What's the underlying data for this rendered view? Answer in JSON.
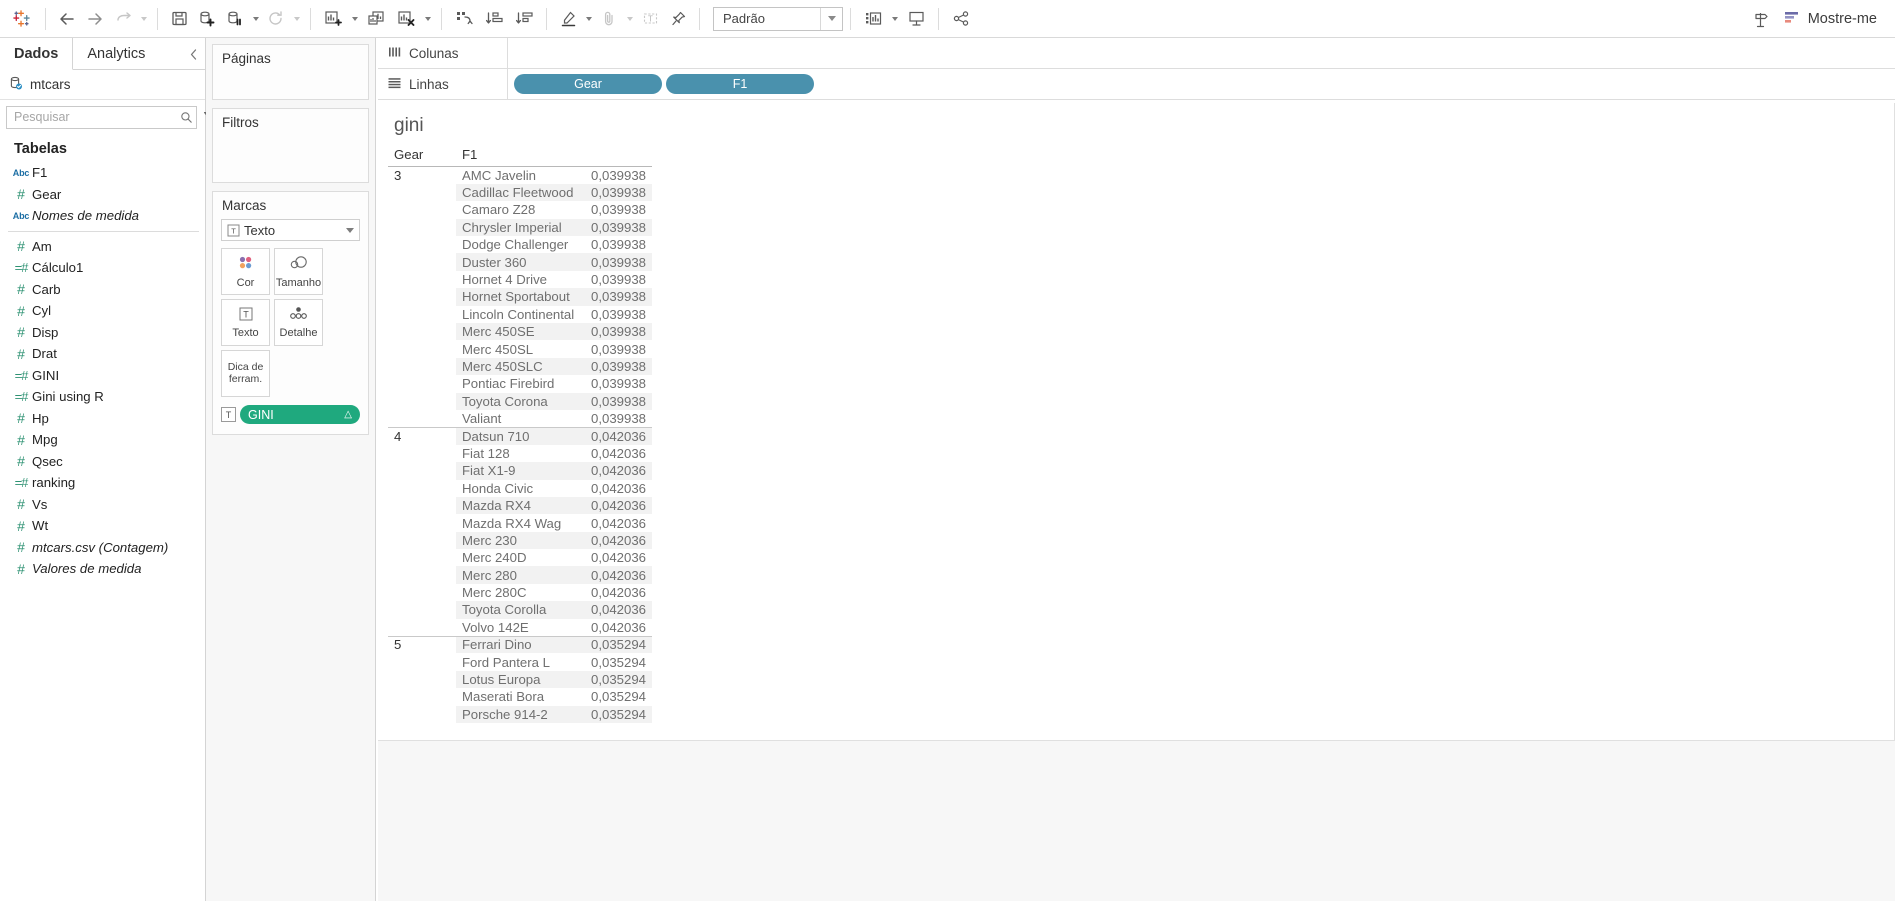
{
  "toolbar": {
    "logo_icon": "tableau-logo-icon",
    "groups": [
      {
        "items": [
          {
            "name": "back-button",
            "icon": "arrow-left-icon",
            "dim": false,
            "caret": false
          },
          {
            "name": "forward-button",
            "icon": "arrow-right-icon",
            "dim": false,
            "caret": false
          },
          {
            "name": "undo-redo-button",
            "icon": "redo-arrow-icon",
            "dim": true,
            "caret": true
          }
        ]
      },
      {
        "items": [
          {
            "name": "save-button",
            "icon": "save-floppy-icon",
            "dim": false,
            "caret": false
          },
          {
            "name": "new-data-source-button",
            "icon": "database-plus-icon",
            "dim": false,
            "caret": false
          },
          {
            "name": "pause-data-source-button",
            "icon": "database-pause-icon",
            "dim": false,
            "caret": true
          },
          {
            "name": "refresh-data-source-button",
            "icon": "refresh-circular-icon",
            "dim": true,
            "caret": true
          }
        ]
      },
      {
        "items": [
          {
            "name": "new-worksheet-button",
            "icon": "chart-plus-icon",
            "dim": false,
            "caret": true
          },
          {
            "name": "duplicate-sheet-button",
            "icon": "chart-duplicate-icon",
            "dim": false,
            "caret": false
          },
          {
            "name": "clear-sheet-button",
            "icon": "chart-clear-x-icon",
            "dim": false,
            "caret": true
          }
        ]
      },
      {
        "items": [
          {
            "name": "swap-rows-columns-button",
            "icon": "swap-axes-icon",
            "dim": false,
            "caret": false
          },
          {
            "name": "sort-ascending-button",
            "icon": "sort-ascending-icon",
            "dim": false,
            "caret": false
          },
          {
            "name": "sort-descending-button",
            "icon": "sort-descending-icon",
            "dim": false,
            "caret": false
          }
        ]
      },
      {
        "items": [
          {
            "name": "highlight-button",
            "icon": "highlighter-pen-icon",
            "dim": false,
            "caret": true
          },
          {
            "name": "group-members-button",
            "icon": "paperclip-icon",
            "dim": true,
            "caret": true
          },
          {
            "name": "show-mark-labels-button",
            "icon": "text-label-icon",
            "dim": true,
            "caret": false
          },
          {
            "name": "fix-axes-button",
            "icon": "pushpin-icon",
            "dim": false,
            "caret": false
          }
        ]
      }
    ],
    "fit_select": {
      "value": "Padrão"
    },
    "after_fit": [
      {
        "name": "show-hide-cards-button",
        "icon": "cards-chart-icon",
        "dim": false,
        "caret": true
      },
      {
        "name": "presentation-mode-button",
        "icon": "presentation-screen-icon",
        "dim": false,
        "caret": false
      },
      {
        "name": "share-button",
        "icon": "share-nodes-icon",
        "dim": false,
        "caret": false
      }
    ],
    "signpost_icon": "signpost-icon",
    "show_me_label": "Mostre-me",
    "show_me_icon": "show-me-bars-icon"
  },
  "left_pane": {
    "tabs": [
      {
        "label": "Dados",
        "active": true
      },
      {
        "label": "Analytics",
        "active": false
      }
    ],
    "collapse_icon": "chevron-left-icon",
    "data_source": {
      "label": "mtcars",
      "icon": "database-connected-icon"
    },
    "search": {
      "placeholder": "Pesquisar",
      "value": ""
    },
    "search_icon": "search-magnifier-icon",
    "filter_icon": "funnel-filter-icon",
    "grid_icon": "grid-view-icon",
    "section_title": "Tabelas",
    "fields_group_1": [
      {
        "label": "F1",
        "type": "abc",
        "italic": false
      },
      {
        "label": "Gear",
        "type": "num",
        "italic": false
      },
      {
        "label": "Nomes de medida",
        "type": "abc",
        "italic": true
      }
    ],
    "fields_group_2": [
      {
        "label": "Am",
        "type": "num",
        "italic": false
      },
      {
        "label": "Cálculo1",
        "type": "calc",
        "italic": false
      },
      {
        "label": "Carb",
        "type": "num",
        "italic": false
      },
      {
        "label": "Cyl",
        "type": "num",
        "italic": false
      },
      {
        "label": "Disp",
        "type": "num",
        "italic": false
      },
      {
        "label": "Drat",
        "type": "num",
        "italic": false
      },
      {
        "label": "GINI",
        "type": "calc",
        "italic": false
      },
      {
        "label": "Gini using R",
        "type": "calc",
        "italic": false
      },
      {
        "label": "Hp",
        "type": "num",
        "italic": false
      },
      {
        "label": "Mpg",
        "type": "num",
        "italic": false
      },
      {
        "label": "Qsec",
        "type": "num",
        "italic": false
      },
      {
        "label": "ranking",
        "type": "calc",
        "italic": false
      },
      {
        "label": "Vs",
        "type": "num",
        "italic": false
      },
      {
        "label": "Wt",
        "type": "num",
        "italic": false
      },
      {
        "label": "mtcars.csv (Contagem)",
        "type": "num",
        "italic": true
      },
      {
        "label": "Valores de medida",
        "type": "num",
        "italic": true
      }
    ]
  },
  "cards": {
    "pages_title": "Páginas",
    "filters_title": "Filtros",
    "marks_title": "Marcas",
    "mark_type": {
      "label": "Texto",
      "icon": "text-mark-icon"
    },
    "mark_buttons": [
      {
        "label": "Cor",
        "icon": "color-dots-icon"
      },
      {
        "label": "Tamanho",
        "icon": "size-circles-icon"
      },
      {
        "label": "Texto",
        "icon": "text-box-icon"
      },
      {
        "label": "Detalhe",
        "icon": "detail-dots-icon"
      },
      {
        "label": "Dica de ferram.",
        "icon": "tooltip-icon"
      }
    ],
    "marks_pill": {
      "label": "GINI",
      "icon": "text-mark-icon",
      "suffix": "△",
      "color": "#1fa97e"
    }
  },
  "shelves": {
    "columns": {
      "label": "Colunas",
      "icon": "columns-icon",
      "pills": []
    },
    "rows": {
      "label": "Linhas",
      "icon": "rows-icon",
      "pills": [
        {
          "label": "Gear",
          "color": "#4a91ad"
        },
        {
          "label": "F1",
          "color": "#4a91ad"
        }
      ]
    }
  },
  "viz": {
    "title": "gini",
    "columns": [
      "Gear",
      "F1",
      ""
    ],
    "rows": [
      {
        "gear": "3",
        "f1": "AMC Javelin",
        "value": "0,039938",
        "group_start": true
      },
      {
        "gear": "",
        "f1": "Cadillac Fleetwood",
        "value": "0,039938",
        "group_start": false
      },
      {
        "gear": "",
        "f1": "Camaro Z28",
        "value": "0,039938",
        "group_start": false
      },
      {
        "gear": "",
        "f1": "Chrysler Imperial",
        "value": "0,039938",
        "group_start": false
      },
      {
        "gear": "",
        "f1": "Dodge Challenger",
        "value": "0,039938",
        "group_start": false
      },
      {
        "gear": "",
        "f1": "Duster 360",
        "value": "0,039938",
        "group_start": false
      },
      {
        "gear": "",
        "f1": "Hornet 4 Drive",
        "value": "0,039938",
        "group_start": false
      },
      {
        "gear": "",
        "f1": "Hornet Sportabout",
        "value": "0,039938",
        "group_start": false
      },
      {
        "gear": "",
        "f1": "Lincoln Continental",
        "value": "0,039938",
        "group_start": false
      },
      {
        "gear": "",
        "f1": "Merc 450SE",
        "value": "0,039938",
        "group_start": false
      },
      {
        "gear": "",
        "f1": "Merc 450SL",
        "value": "0,039938",
        "group_start": false
      },
      {
        "gear": "",
        "f1": "Merc 450SLC",
        "value": "0,039938",
        "group_start": false
      },
      {
        "gear": "",
        "f1": "Pontiac Firebird",
        "value": "0,039938",
        "group_start": false
      },
      {
        "gear": "",
        "f1": "Toyota Corona",
        "value": "0,039938",
        "group_start": false
      },
      {
        "gear": "",
        "f1": "Valiant",
        "value": "0,039938",
        "group_start": false
      },
      {
        "gear": "4",
        "f1": "Datsun 710",
        "value": "0,042036",
        "group_start": true
      },
      {
        "gear": "",
        "f1": "Fiat 128",
        "value": "0,042036",
        "group_start": false
      },
      {
        "gear": "",
        "f1": "Fiat X1-9",
        "value": "0,042036",
        "group_start": false
      },
      {
        "gear": "",
        "f1": "Honda Civic",
        "value": "0,042036",
        "group_start": false
      },
      {
        "gear": "",
        "f1": "Mazda RX4",
        "value": "0,042036",
        "group_start": false
      },
      {
        "gear": "",
        "f1": "Mazda RX4 Wag",
        "value": "0,042036",
        "group_start": false
      },
      {
        "gear": "",
        "f1": "Merc 230",
        "value": "0,042036",
        "group_start": false
      },
      {
        "gear": "",
        "f1": "Merc 240D",
        "value": "0,042036",
        "group_start": false
      },
      {
        "gear": "",
        "f1": "Merc 280",
        "value": "0,042036",
        "group_start": false
      },
      {
        "gear": "",
        "f1": "Merc 280C",
        "value": "0,042036",
        "group_start": false
      },
      {
        "gear": "",
        "f1": "Toyota Corolla",
        "value": "0,042036",
        "group_start": false
      },
      {
        "gear": "",
        "f1": "Volvo 142E",
        "value": "0,042036",
        "group_start": false
      },
      {
        "gear": "5",
        "f1": "Ferrari Dino",
        "value": "0,035294",
        "group_start": true
      },
      {
        "gear": "",
        "f1": "Ford Pantera L",
        "value": "0,035294",
        "group_start": false
      },
      {
        "gear": "",
        "f1": "Lotus Europa",
        "value": "0,035294",
        "group_start": false
      },
      {
        "gear": "",
        "f1": "Maserati Bora",
        "value": "0,035294",
        "group_start": false
      },
      {
        "gear": "",
        "f1": "Porsche 914-2",
        "value": "0,035294",
        "group_start": false
      }
    ]
  }
}
